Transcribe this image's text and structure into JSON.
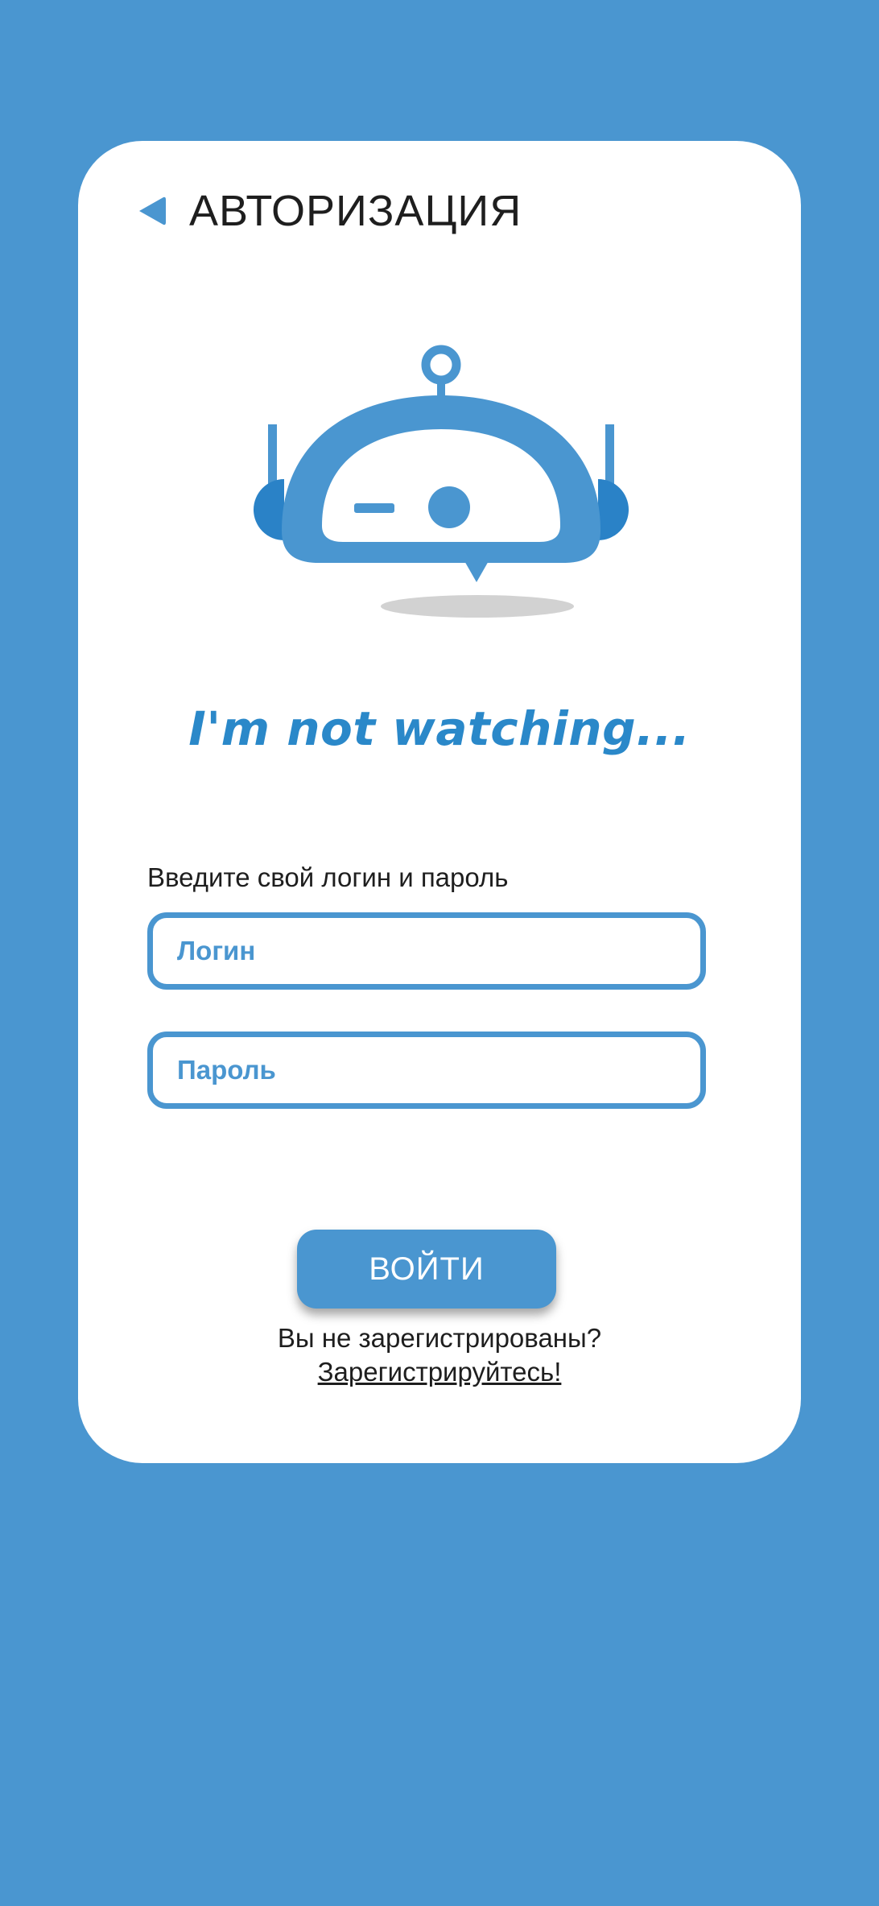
{
  "header": {
    "title": "АВТОРИЗАЦИЯ",
    "back_icon": "back-triangle-icon"
  },
  "mascot": {
    "icon": "robot-mascot-icon",
    "tagline": "I'm not watching..."
  },
  "form": {
    "label": "Введите свой логин и пароль",
    "login_placeholder": "Логин",
    "password_placeholder": "Пароль",
    "submit_label": "ВОЙТИ"
  },
  "register": {
    "prompt": "Вы не зарегистрированы?",
    "link_label": "Зарегистрируйтесь!"
  },
  "colors": {
    "background": "#4a96d0",
    "card": "#ffffff",
    "accent": "#4a96d0",
    "tagline": "#2a88c9",
    "text": "#1e1e1e"
  }
}
